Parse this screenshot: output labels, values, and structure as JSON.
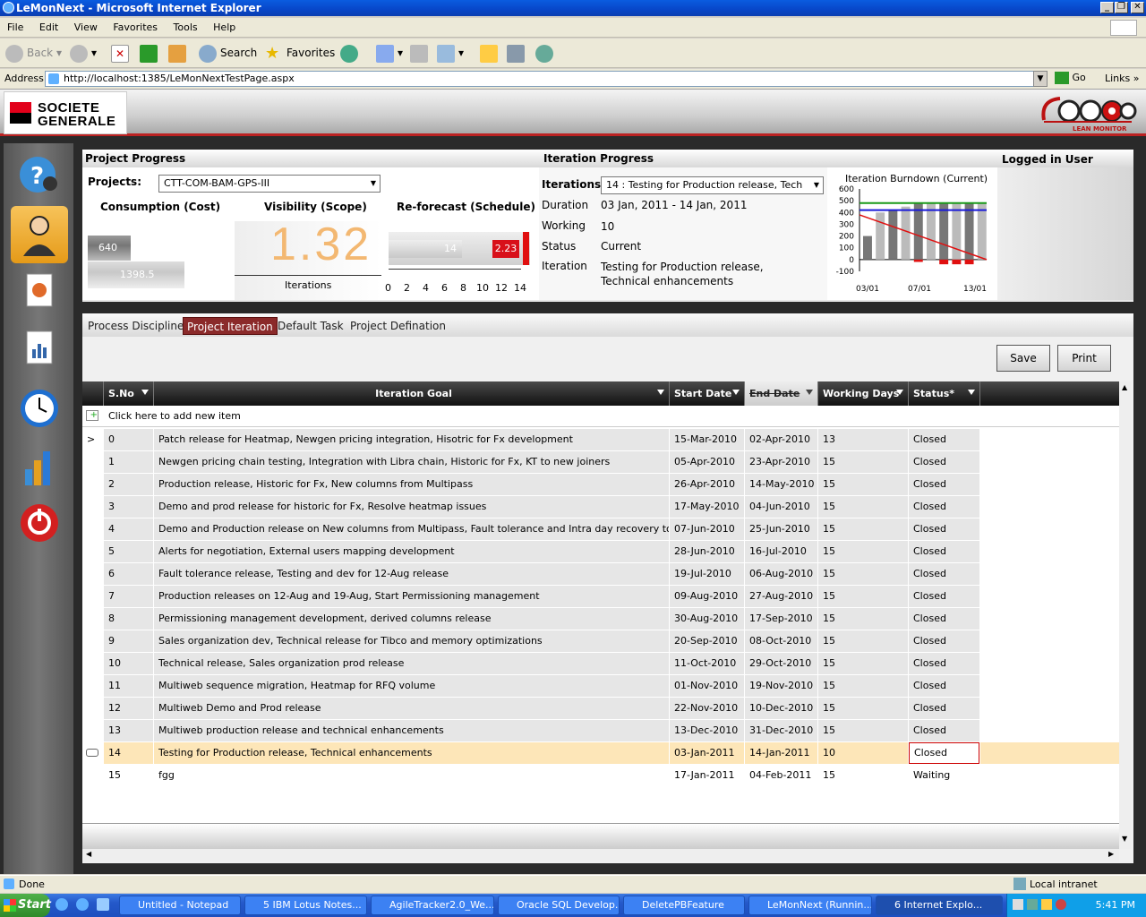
{
  "window": {
    "title": "LeMonNext - Microsoft Internet Explorer"
  },
  "menu": [
    "File",
    "Edit",
    "View",
    "Favorites",
    "Tools",
    "Help"
  ],
  "toolbar": {
    "back": "Back",
    "search": "Search",
    "favorites": "Favorites"
  },
  "address": {
    "label": "Address",
    "url": "http://localhost:1385/LeMonNextTestPage.aspx",
    "go": "Go",
    "links": "Links"
  },
  "brand": {
    "line1": "SOCIETE",
    "line2": "GENERALE",
    "app_logo_text": "LEAN MONITOR"
  },
  "project_progress": {
    "title": "Project Progress",
    "projects_label": "Projects:",
    "project_value": "CTT-COM-BAM-GPS-III",
    "consumption_title": "Consumption (Cost)",
    "consumption_bar1": "640",
    "consumption_bar2": "1398.5",
    "visibility_title": "Visibility (Scope)",
    "visibility_value": "1.32",
    "visibility_label": "Iterations",
    "reforecast_title": "Re-forecast (Schedule)",
    "reforecast_bar1": "14",
    "reforecast_bar2": "2.23",
    "reforecast_axis": [
      "0",
      "2",
      "4",
      "6",
      "8",
      "10",
      "12",
      "14"
    ]
  },
  "iteration_progress": {
    "title": "Iteration Progress",
    "iterations_label": "Iterations:",
    "iterations_value": "14 : Testing for Production release, Tech",
    "duration_label": "Duration",
    "duration_value": "03 Jan, 2011 - 14 Jan, 2011",
    "working_label": "Working",
    "working_value": "10",
    "status_label": "Status",
    "status_value": "Current",
    "iteration_label": "Iteration",
    "iteration_value": "Testing for Production release, Technical enhancements"
  },
  "logged_in": "Logged in User",
  "chart_data": {
    "type": "bar",
    "title": "Iteration Burndown (Current)",
    "y_ticks": [
      "600",
      "500",
      "400",
      "300",
      "200",
      "100",
      "0",
      "-100"
    ],
    "x_ticks": [
      "03/01",
      "07/01",
      "13/01"
    ],
    "ylim": [
      -100,
      600
    ],
    "bars_gray": [
      200,
      400,
      420,
      450,
      480,
      480,
      480,
      480,
      480,
      480
    ],
    "bars_red": [
      0,
      0,
      0,
      0,
      -20,
      0,
      -40,
      -40,
      -40,
      0
    ],
    "ideal_line": [
      380,
      0
    ],
    "capacity_green": 480,
    "capacity_blue": 420
  },
  "tabs": [
    "Process Discipline",
    "Project Iteration",
    "Default Task",
    "Project Defination"
  ],
  "buttons": {
    "save": "Save",
    "print": "Print"
  },
  "grid": {
    "headers": [
      "S.No",
      "Iteration Goal",
      "Start Date",
      "End Date",
      "Working Days",
      "Status*"
    ],
    "add_new": "Click here to add new item",
    "rows": [
      [
        "0",
        "Patch release for Heatmap, Newgen pricing integration, Hisotric for Fx development",
        "15-Mar-2010",
        "02-Apr-2010",
        "13",
        "Closed"
      ],
      [
        "1",
        "Newgen pricing chain testing, Integration with Libra chain, Historic for Fx, KT to new joiners",
        "05-Apr-2010",
        "23-Apr-2010",
        "15",
        "Closed"
      ],
      [
        "2",
        "Production release, Historic for Fx, New columns from Multipass",
        "26-Apr-2010",
        "14-May-2010",
        "15",
        "Closed"
      ],
      [
        "3",
        "Demo and prod release for historic for Fx, Resolve heatmap issues",
        "17-May-2010",
        "04-Jun-2010",
        "15",
        "Closed"
      ],
      [
        "4",
        "Demo and Production release on New columns from Multipass, Fault tolerance and Intra day recovery tool for Fx",
        "07-Jun-2010",
        "25-Jun-2010",
        "15",
        "Closed"
      ],
      [
        "5",
        "Alerts for negotiation, External users mapping development",
        "28-Jun-2010",
        "16-Jul-2010",
        "15",
        "Closed"
      ],
      [
        "6",
        "Fault tolerance release, Testing and dev for 12-Aug release",
        "19-Jul-2010",
        "06-Aug-2010",
        "15",
        "Closed"
      ],
      [
        "7",
        "Production releases on 12-Aug and 19-Aug, Start Permissioning management",
        "09-Aug-2010",
        "27-Aug-2010",
        "15",
        "Closed"
      ],
      [
        "8",
        "Permissioning management development, derived columns release",
        "30-Aug-2010",
        "17-Sep-2010",
        "15",
        "Closed"
      ],
      [
        "9",
        "Sales organization dev, Technical release for Tibco and memory optimizations",
        "20-Sep-2010",
        "08-Oct-2010",
        "15",
        "Closed"
      ],
      [
        "10",
        "Technical release, Sales organization prod release",
        "11-Oct-2010",
        "29-Oct-2010",
        "15",
        "Closed"
      ],
      [
        "11",
        "Multiweb sequence migration, Heatmap for RFQ volume",
        "01-Nov-2010",
        "19-Nov-2010",
        "15",
        "Closed"
      ],
      [
        "12",
        "Multiweb Demo and Prod release",
        "22-Nov-2010",
        "10-Dec-2010",
        "15",
        "Closed"
      ],
      [
        "13",
        "Multiweb production release and technical enhancements",
        "13-Dec-2010",
        "31-Dec-2010",
        "15",
        "Closed"
      ],
      [
        "14",
        "Testing for Production release, Technical enhancements",
        "03-Jan-2011",
        "14-Jan-2011",
        "10",
        "Closed"
      ],
      [
        "15",
        "fgg",
        "17-Jan-2011",
        "04-Feb-2011",
        "15",
        "Waiting"
      ]
    ]
  },
  "statusbar": {
    "left": "Done",
    "zone": "Local intranet"
  },
  "taskbar": {
    "start": "Start",
    "tasks": [
      "Untitled - Notepad",
      "5 IBM Lotus Notes...",
      "AgileTracker2.0_We...",
      "Oracle SQL Develop...",
      "DeletePBFeature",
      "LeMonNext (Runnin...",
      "6 Internet Explo..."
    ],
    "clock": "5:41 PM"
  }
}
